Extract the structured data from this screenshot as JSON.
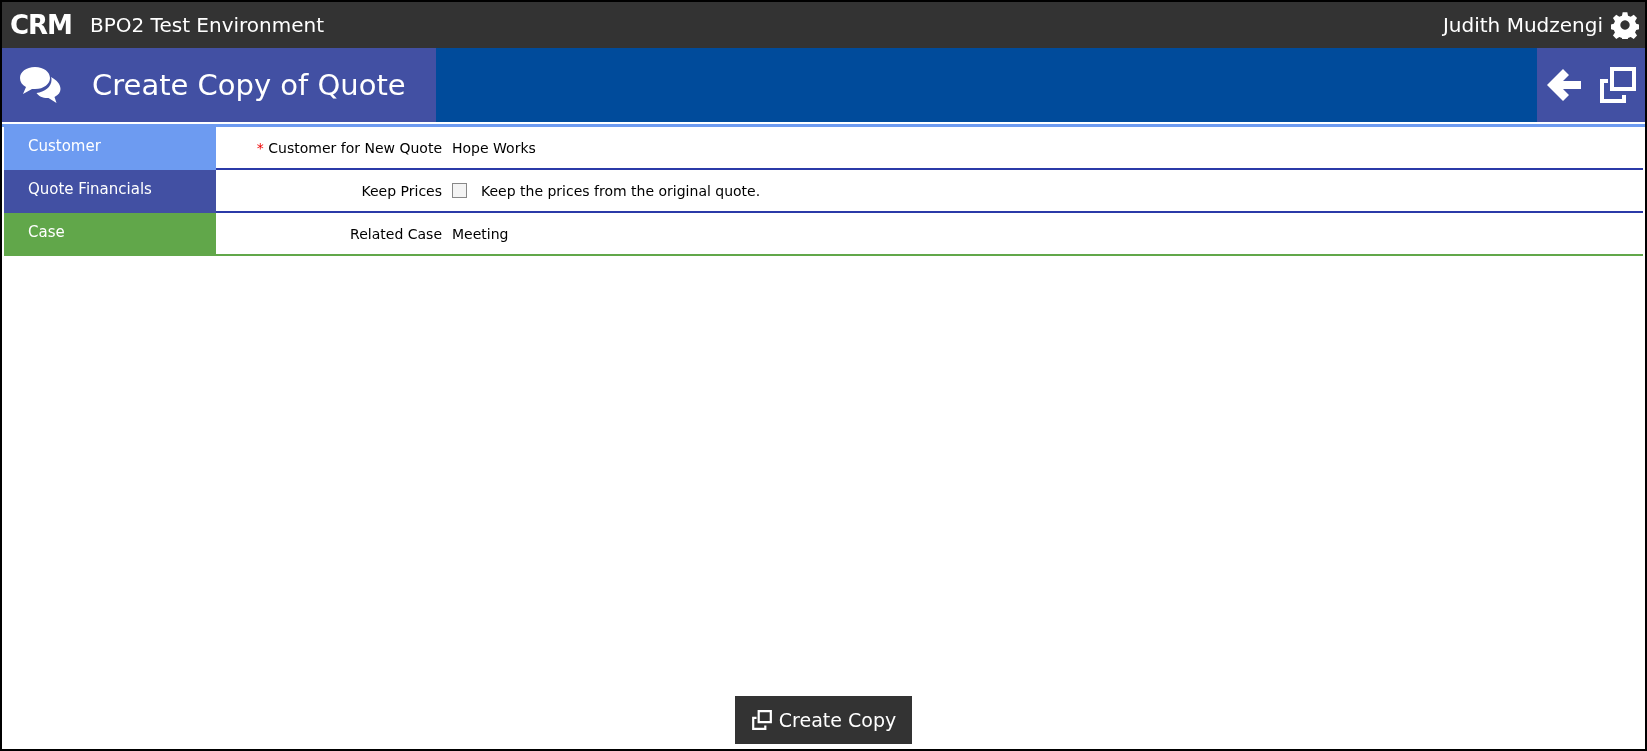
{
  "top_bar": {
    "logo": "CRM",
    "environment": "BPO2 Test Environment",
    "user": "Judith Mudzengi"
  },
  "header": {
    "title": "Create Copy of Quote"
  },
  "sections": [
    {
      "label": "Customer",
      "color": "#6d9bf1",
      "fields": [
        {
          "kind": "text",
          "label": "Customer for New Quote",
          "marker": "*",
          "value": "Hope Works"
        }
      ]
    },
    {
      "label": "Quote Financials",
      "color": "#4250a3",
      "fields": [
        {
          "kind": "checkbox",
          "label": "Keep Prices",
          "checked": false,
          "value": "Keep the prices from the original quote."
        }
      ]
    },
    {
      "label": "Case",
      "color": "#61a74a",
      "fields": [
        {
          "kind": "text",
          "label": "Related Case",
          "value": "Meeting"
        }
      ]
    }
  ],
  "footer": {
    "button": "Create Copy"
  }
}
